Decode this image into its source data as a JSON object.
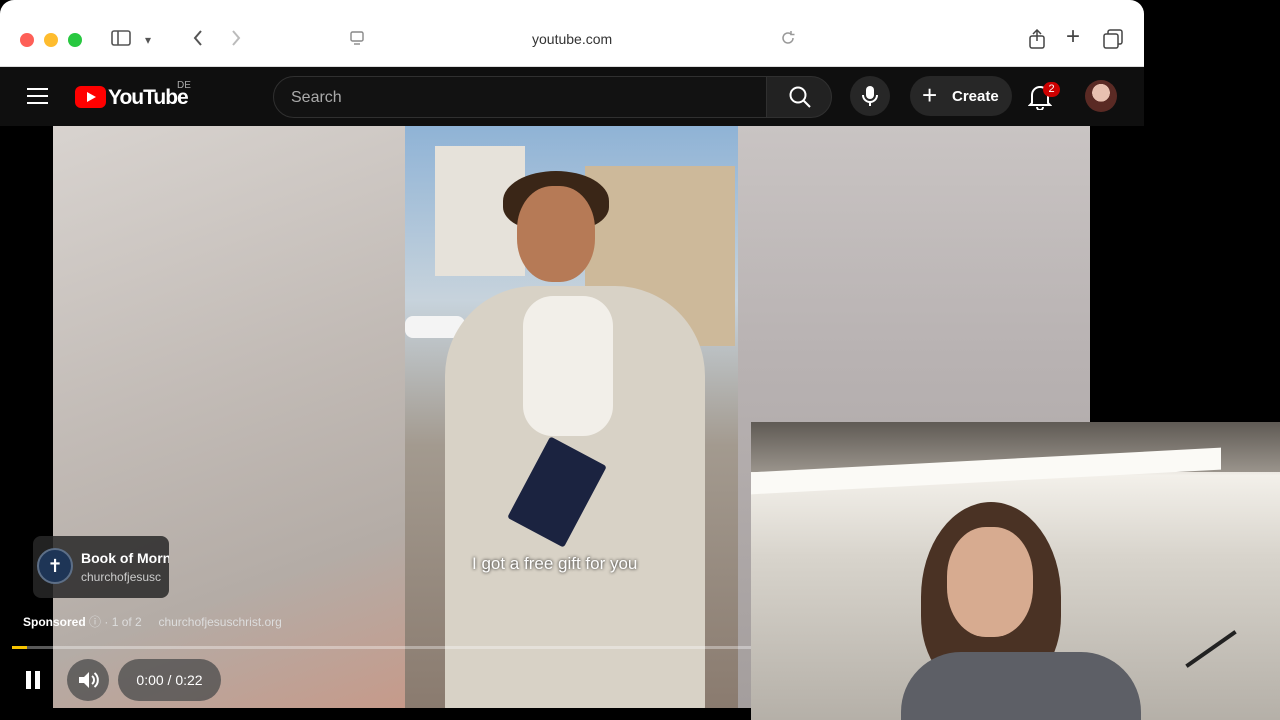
{
  "browser": {
    "url": "youtube.com",
    "traffic_colors": [
      "#fe5f57",
      "#febc2e",
      "#28c840"
    ]
  },
  "youtube": {
    "logo_text": "YouTube",
    "region": "DE",
    "search_placeholder": "Search",
    "create_label": "Create",
    "notification_count": "2",
    "brand_color": "#ff0000"
  },
  "video": {
    "caption": "I got a free gift for you",
    "ad_title": "Book of Morn",
    "ad_channel": "churchofjesusc",
    "sponsored_label": "Sponsored",
    "ad_position": "1 of 2",
    "ad_domain": "churchofjesuschrist.org",
    "time_display": "0:00 / 0:22",
    "progress": 0.02,
    "progress_color": "#f7c400"
  }
}
